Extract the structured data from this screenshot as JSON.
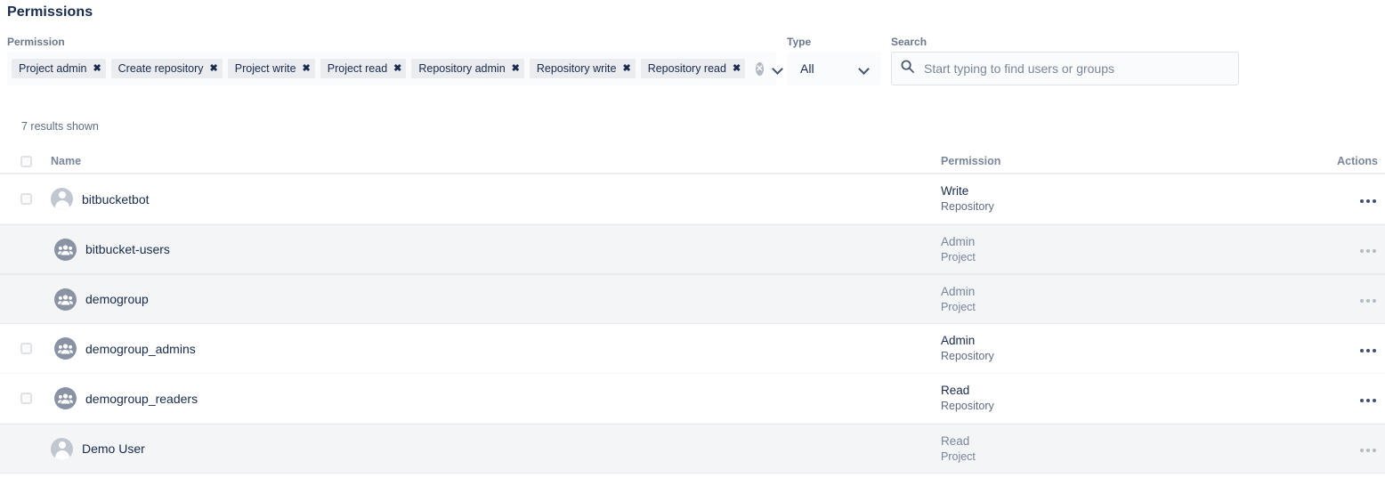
{
  "page_title": "Permissions",
  "filters": {
    "permission": {
      "label": "Permission",
      "chips": [
        {
          "label": "Project admin",
          "remove": "✖"
        },
        {
          "label": "Create repository",
          "remove": "✖"
        },
        {
          "label": "Project write",
          "remove": "✖"
        },
        {
          "label": "Project read",
          "remove": "✖"
        },
        {
          "label": "Repository admin",
          "remove": "✖"
        },
        {
          "label": "Repository write",
          "remove": "✖"
        },
        {
          "label": "Repository read",
          "remove": "✖"
        }
      ],
      "clear_all_icon": "✕",
      "clear_all_name": "clear-all-icon",
      "dropdown_icon": "chevron-down-icon"
    },
    "type": {
      "label": "Type",
      "value": "All",
      "options": [
        "All"
      ],
      "dropdown_icon": "chevron-down-icon"
    },
    "search": {
      "label": "Search",
      "value": "",
      "placeholder": "Start typing to find users or groups",
      "icon": "search-icon"
    }
  },
  "results_count": "7 results shown",
  "table": {
    "headers": {
      "name": "Name",
      "permission": "Permission",
      "actions": "Actions"
    },
    "rows": [
      {
        "name": "bitbucketbot",
        "kind": "user",
        "checkbox": true,
        "permission": "Write",
        "scope": "Repository",
        "inherited": false,
        "actions_icon": "more-actions-icon"
      },
      {
        "name": "bitbucket-users",
        "kind": "group",
        "checkbox": false,
        "permission": "Admin",
        "scope": "Project",
        "inherited": true,
        "actions_icon": "more-actions-icon"
      },
      {
        "name": "demogroup",
        "kind": "group",
        "checkbox": false,
        "permission": "Admin",
        "scope": "Project",
        "inherited": true,
        "actions_icon": "more-actions-icon"
      },
      {
        "name": "demogroup_admins",
        "kind": "group",
        "checkbox": true,
        "permission": "Admin",
        "scope": "Repository",
        "inherited": false,
        "actions_icon": "more-actions-icon"
      },
      {
        "name": "demogroup_readers",
        "kind": "group",
        "checkbox": true,
        "permission": "Read",
        "scope": "Repository",
        "inherited": false,
        "actions_icon": "more-actions-icon"
      },
      {
        "name": "Demo User",
        "kind": "user",
        "checkbox": false,
        "permission": "Read",
        "scope": "Project",
        "inherited": true,
        "actions_icon": "more-actions-icon"
      }
    ]
  },
  "colors": {
    "text": "#172b4d",
    "subtle_text": "#6b778c",
    "inherited_row_bg": "#f4f5f7",
    "chip_bg": "#ebecf0",
    "field_bg": "#fafbfc",
    "border": "#dfe1e6"
  }
}
